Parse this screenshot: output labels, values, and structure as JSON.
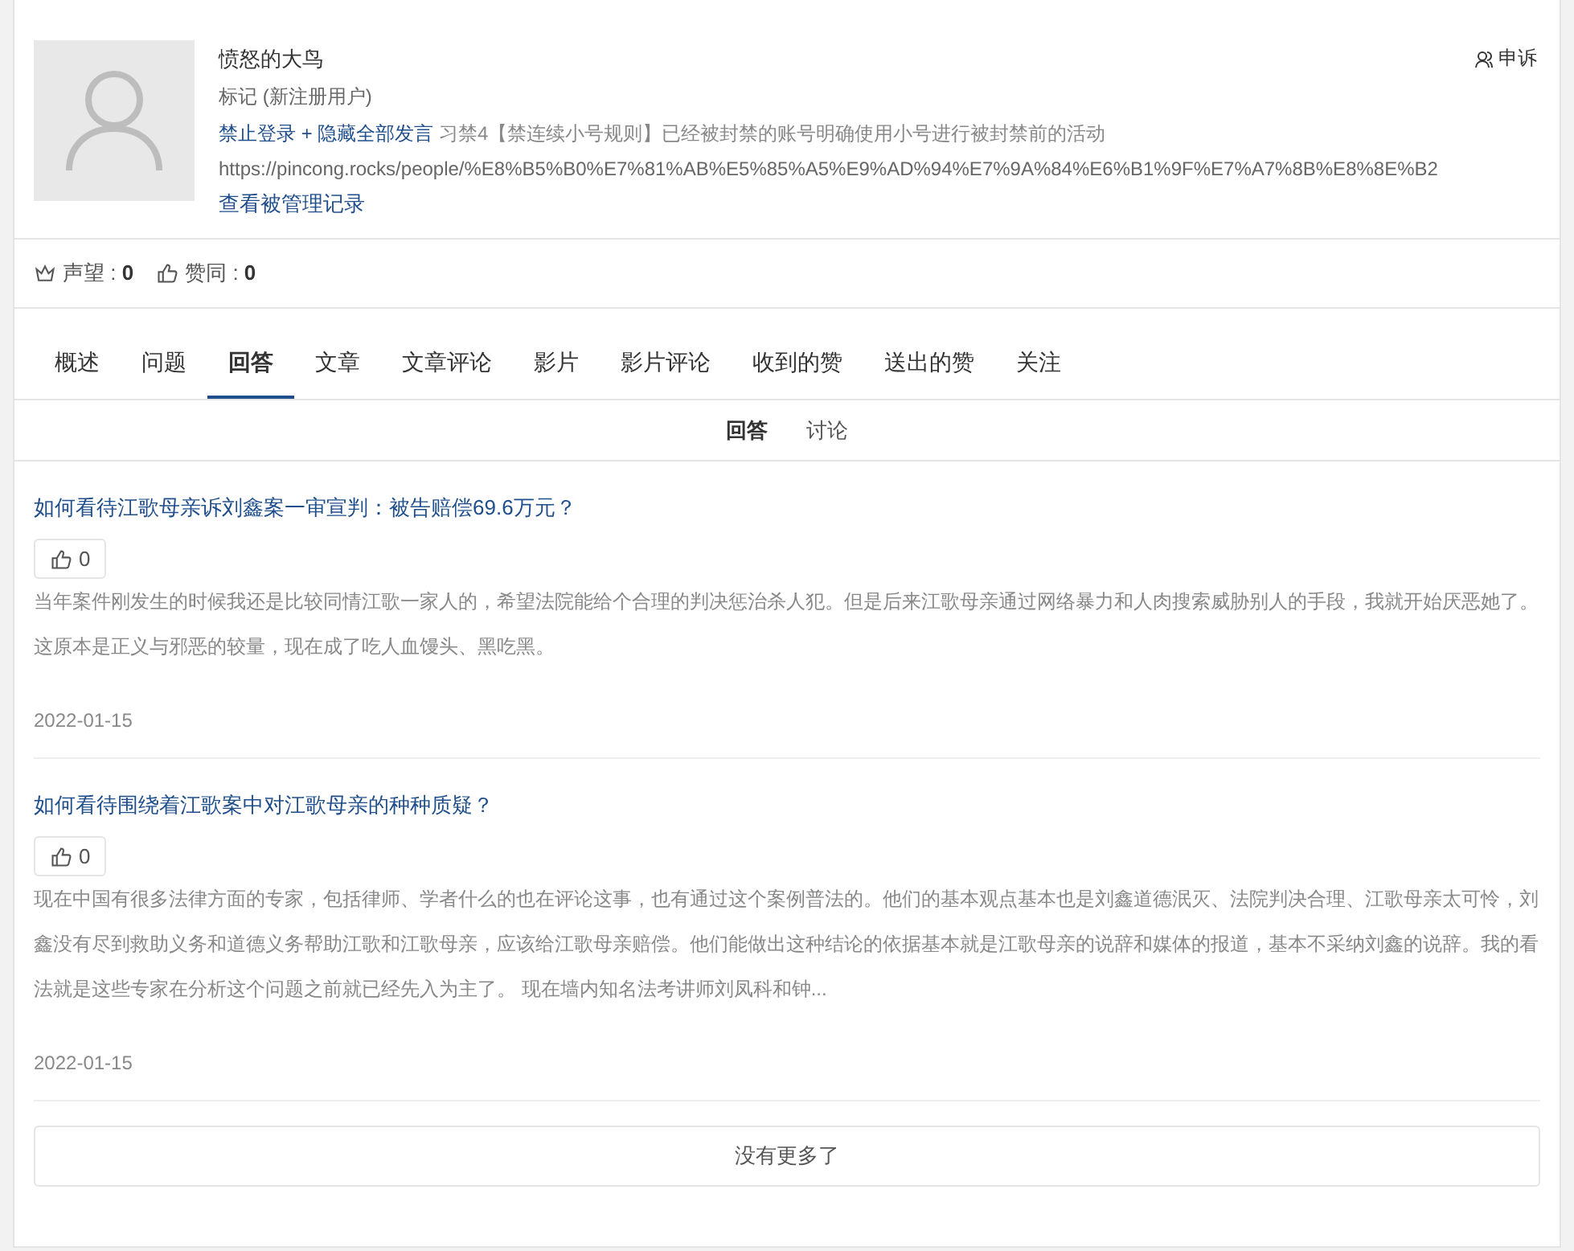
{
  "profile": {
    "name": "愤怒的大鸟",
    "tag": "标记 (新注册用户)",
    "ban_status": "禁止登录 + 隐藏全部发言",
    "ban_reason": "习禁4【禁连续小号规则】已经被封禁的账号明确使用小号进行被封禁前的活动",
    "url": "https://pincong.rocks/people/%E8%B5%B0%E7%81%AB%E5%85%A5%E9%AD%94%E7%9A%84%E6%B1%9F%E7%A7%8B%E8%8E%B2",
    "manage_log_link": "查看被管理记录",
    "appeal_button": "申诉"
  },
  "stats": [
    {
      "kind": "reputation",
      "label": "声望 : ",
      "value": "0"
    },
    {
      "kind": "agree",
      "label": "赞同 : ",
      "value": "0"
    }
  ],
  "tabs": [
    {
      "label": "概述",
      "selected": false
    },
    {
      "label": "问题",
      "selected": false
    },
    {
      "label": "回答",
      "selected": true
    },
    {
      "label": "文章",
      "selected": false
    },
    {
      "label": "文章评论",
      "selected": false
    },
    {
      "label": "影片",
      "selected": false
    },
    {
      "label": "影片评论",
      "selected": false
    },
    {
      "label": "收到的赞",
      "selected": false
    },
    {
      "label": "送出的赞",
      "selected": false
    },
    {
      "label": "关注",
      "selected": false
    }
  ],
  "subtabs": [
    {
      "label": "回答",
      "selected": true
    },
    {
      "label": "讨论",
      "selected": false
    }
  ],
  "answers": [
    {
      "question": "如何看待江歌母亲诉刘鑫案一审宣判：被告赔偿69.6万元？",
      "votes": "0",
      "text": "当年案件刚发生的时候我还是比较同情江歌一家人的，希望法院能给个合理的判决惩治杀人犯。但是后来江歌母亲通过网络暴力和人肉搜索威胁别人的手段，我就开始厌恶她了。这原本是正义与邪恶的较量，现在成了吃人血馒头、黑吃黑。",
      "date": "2022-01-15"
    },
    {
      "question": "如何看待围绕着江歌案中对江歌母亲的种种质疑？",
      "votes": "0",
      "text": "现在中国有很多法律方面的专家，包括律师、学者什么的也在评论这事，也有通过这个案例普法的。他们的基本观点基本也是刘鑫道德泯灭、法院判决合理、江歌母亲太可怜，刘鑫没有尽到救助义务和道德义务帮助江歌和江歌母亲，应该给江歌母亲赔偿。他们能做出这种结论的依据基本就是江歌母亲的说辞和媒体的报道，基本不采纳刘鑫的说辞。我的看法就是这些专家在分析这个问题之前就已经先入为主了。 现在墙内知名法考讲师刘凤科和钟...",
      "date": "2022-01-15"
    }
  ],
  "no_more": "没有更多了"
}
